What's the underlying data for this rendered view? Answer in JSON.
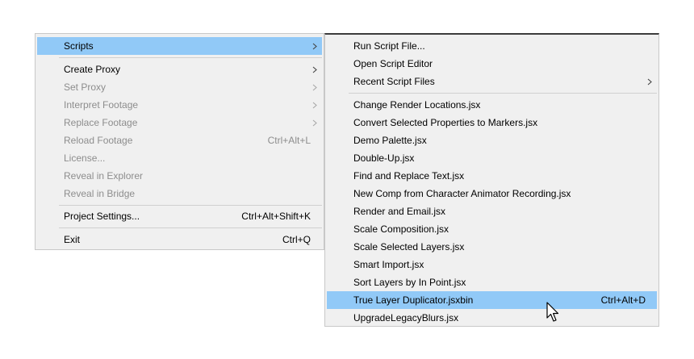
{
  "main_menu": {
    "items": [
      {
        "label": "Scripts",
        "shortcut": ""
      },
      {
        "label": "Create Proxy",
        "shortcut": ""
      },
      {
        "label": "Set Proxy",
        "shortcut": ""
      },
      {
        "label": "Interpret Footage",
        "shortcut": ""
      },
      {
        "label": "Replace Footage",
        "shortcut": ""
      },
      {
        "label": "Reload Footage",
        "shortcut": "Ctrl+Alt+L"
      },
      {
        "label": "License...",
        "shortcut": ""
      },
      {
        "label": "Reveal in Explorer",
        "shortcut": ""
      },
      {
        "label": "Reveal in Bridge",
        "shortcut": ""
      },
      {
        "label": "Project Settings...",
        "shortcut": "Ctrl+Alt+Shift+K"
      },
      {
        "label": "Exit",
        "shortcut": "Ctrl+Q"
      }
    ]
  },
  "scripts_submenu": {
    "items": [
      {
        "label": "Run Script File...",
        "shortcut": ""
      },
      {
        "label": "Open Script Editor",
        "shortcut": ""
      },
      {
        "label": "Recent Script Files",
        "shortcut": ""
      },
      {
        "label": "Change Render Locations.jsx",
        "shortcut": ""
      },
      {
        "label": "Convert Selected Properties to Markers.jsx",
        "shortcut": ""
      },
      {
        "label": "Demo Palette.jsx",
        "shortcut": ""
      },
      {
        "label": "Double-Up.jsx",
        "shortcut": ""
      },
      {
        "label": "Find and Replace Text.jsx",
        "shortcut": ""
      },
      {
        "label": "New Comp from Character Animator Recording.jsx",
        "shortcut": ""
      },
      {
        "label": "Render and Email.jsx",
        "shortcut": ""
      },
      {
        "label": "Scale Composition.jsx",
        "shortcut": ""
      },
      {
        "label": "Scale Selected Layers.jsx",
        "shortcut": ""
      },
      {
        "label": "Smart Import.jsx",
        "shortcut": ""
      },
      {
        "label": "Sort Layers by In Point.jsx",
        "shortcut": ""
      },
      {
        "label": "True Layer Duplicator.jsxbin",
        "shortcut": "Ctrl+Alt+D"
      },
      {
        "label": "UpgradeLegacyBlurs.jsx",
        "shortcut": ""
      }
    ]
  },
  "colors": {
    "menu_bg": "#f0f0f0",
    "highlight": "#91c9f7",
    "disabled_text": "#8d8d8d",
    "separator": "#d0d0d0"
  },
  "icons": {
    "submenu_arrow": "chevron-right-icon",
    "cursor": "mouse-pointer-icon"
  }
}
